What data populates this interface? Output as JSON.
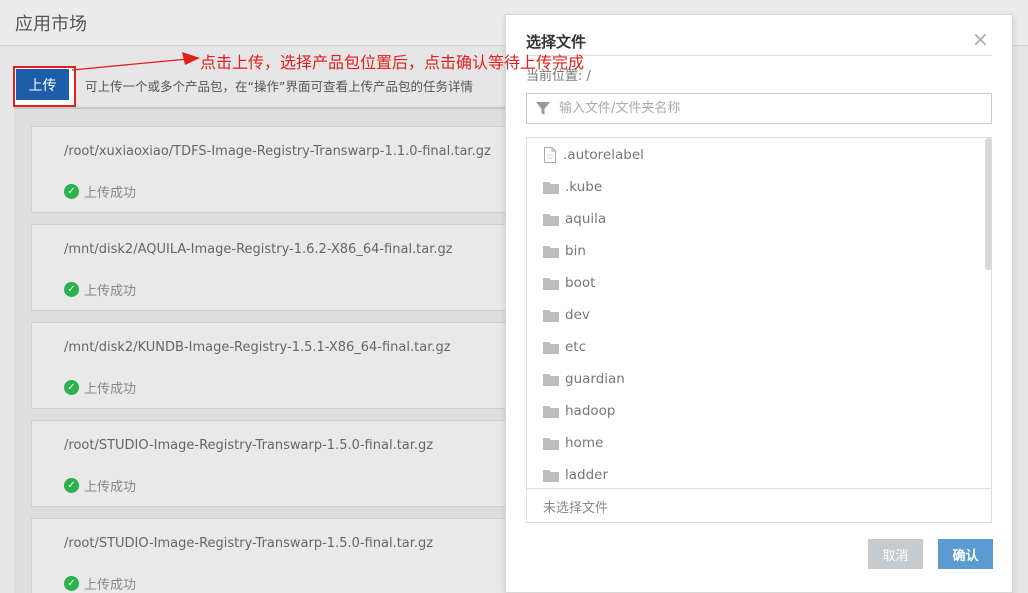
{
  "page": {
    "title": "应用市场"
  },
  "toolbar": {
    "upload_label": "上传",
    "hint": "可上传一个或多个产品包，在“操作”界面可查看上传产品包的任务详情"
  },
  "annotation": {
    "text": "点击上传，选择产品包位置后，点击确认等待上传完成",
    "color": "#e0201f"
  },
  "uploads": [
    {
      "path": "/root/xuxiaoxiao/TDFS-Image-Registry-Transwarp-1.1.0-final.tar.gz",
      "status": "上传成功"
    },
    {
      "path": "/mnt/disk2/AQUILA-Image-Registry-1.6.2-X86_64-final.tar.gz",
      "status": "上传成功"
    },
    {
      "path": "/mnt/disk2/KUNDB-Image-Registry-1.5.1-X86_64-final.tar.gz",
      "status": "上传成功"
    },
    {
      "path": "/root/STUDIO-Image-Registry-Transwarp-1.5.0-final.tar.gz",
      "status": "上传成功"
    },
    {
      "path": "/root/STUDIO-Image-Registry-Transwarp-1.5.0-final.tar.gz",
      "status": "上传成功"
    }
  ],
  "dialog": {
    "title": "选择文件",
    "close_glyph": "×",
    "current_location": "当前位置: /",
    "filter_placeholder": "输入文件/文件夹名称",
    "files": [
      {
        "name": ".autorelabel",
        "icon": "file-icon"
      },
      {
        "name": ".kube",
        "icon": "folder-icon"
      },
      {
        "name": "aquila",
        "icon": "folder-icon"
      },
      {
        "name": "bin",
        "icon": "folder-icon"
      },
      {
        "name": "boot",
        "icon": "folder-icon"
      },
      {
        "name": "dev",
        "icon": "folder-icon"
      },
      {
        "name": "etc",
        "icon": "folder-icon"
      },
      {
        "name": "guardian",
        "icon": "folder-icon"
      },
      {
        "name": "hadoop",
        "icon": "folder-icon"
      },
      {
        "name": "home",
        "icon": "folder-icon"
      },
      {
        "name": "ladder",
        "icon": "folder-icon"
      }
    ],
    "selected_status": "未选择文件",
    "cancel_label": "取消",
    "confirm_label": "确认"
  },
  "colors": {
    "upload_button": "#1c5ca8",
    "success": "#2bb24c",
    "confirm_button": "#5b9bd1",
    "cancel_button": "#c6cbd0"
  }
}
